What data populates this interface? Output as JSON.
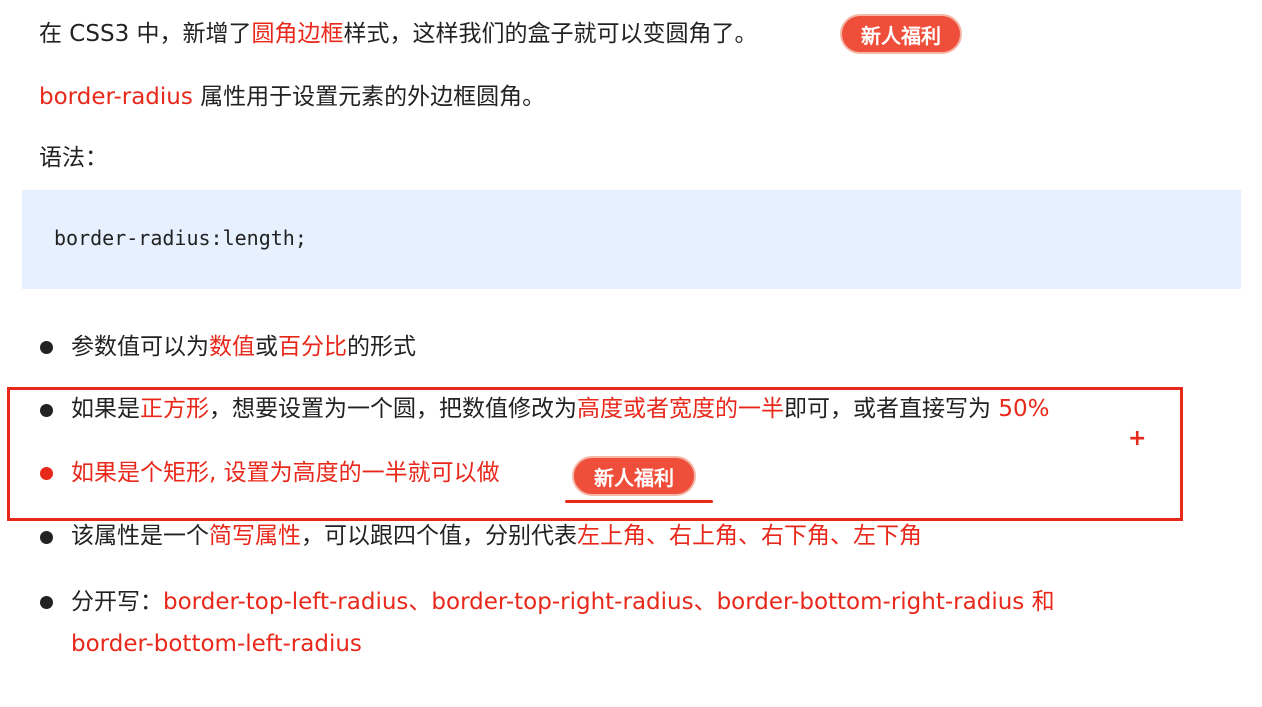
{
  "intro": {
    "prefix": "在 CSS3 中，新增了",
    "highlight": "圆角边框",
    "suffix": "样式，这样我们的盒子就可以变圆角了。"
  },
  "badge_label": "新人福利",
  "property_line": {
    "name": "border-radius",
    "desc": " 属性用于设置元素的外边框圆角。"
  },
  "syntax_label": "语法：",
  "code": "border-radius:length;",
  "bullets": [
    {
      "p1": "参数值可以为",
      "r1": "数值",
      "p2": "或",
      "r2": "百分比",
      "p3": "的形式"
    },
    {
      "p1": "如果是",
      "r1": "正方形",
      "p2": "，想要设置为一个圆，把数值修改为",
      "r2": "高度或者宽度的一半",
      "p3": "即可，或者直接写为 ",
      "r3": "50%"
    },
    {
      "r1": "如果是个矩形, 设置为高度的一半就可以做"
    },
    {
      "p1": "该属性是一个",
      "r1": "简写属性",
      "p2": "，可以跟四个值，分别代表",
      "r2": "左上角、右上角、右下角、左下角"
    },
    {
      "p1": "分开写：",
      "r1": "border-top-left-radius、border-top-right-radius、border-bottom-right-radius 和",
      "r2": "border-bottom-left-radius"
    }
  ],
  "annotation_plus": "+",
  "colors": {
    "accent": "#e8281a",
    "badge": "#ef4f3a",
    "code_bg": "#e6f0ff",
    "text": "#222222"
  }
}
